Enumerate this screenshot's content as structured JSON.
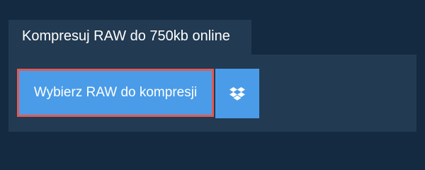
{
  "tab": {
    "title": "Kompresuj RAW do 750kb online"
  },
  "upload": {
    "button_label": "Wybierz RAW do kompresji",
    "dropbox_icon": "dropbox-icon"
  },
  "colors": {
    "background": "#142a40",
    "panel": "#223a52",
    "button": "#4a9ce8",
    "button_border": "#e05a55",
    "text": "#ffffff"
  }
}
